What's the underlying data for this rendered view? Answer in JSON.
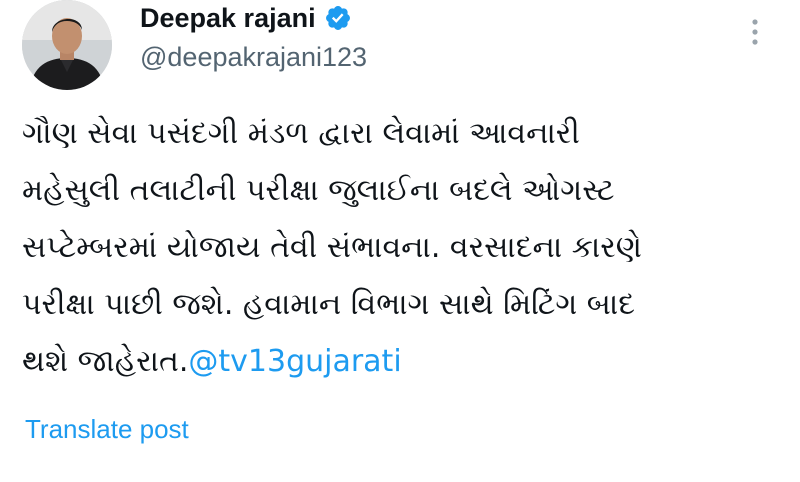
{
  "author": {
    "display_name": "Deepak rajani",
    "handle": "@deepakrajani123",
    "verified": true
  },
  "post": {
    "lines": [
      "ગૌણ સેવા પસંદગી મંડળ દ્વારા લેવામાં આવનારી",
      "મહેસુલી તલાટીની પરીક્ષા જુલાઈના બદલે ઓગસ્ટ",
      "સપ્ટેમ્બરમાં યોજાય તેવી સંભાવના. વરસાદના કારણે",
      "પરીક્ષા પાછી જશે. હવામાન વિભાગ સાથે મિટિંગ બાદ"
    ],
    "last_line_text": "થશે જાહેરાત.",
    "mention": "@tv13gujarati",
    "translate_label": "Translate post"
  },
  "colors": {
    "accent": "#1d9bf0",
    "text": "#0f1419",
    "secondary_text": "#536471"
  },
  "icons": {
    "verified": "verified-badge-icon",
    "more": "more-options-icon"
  }
}
